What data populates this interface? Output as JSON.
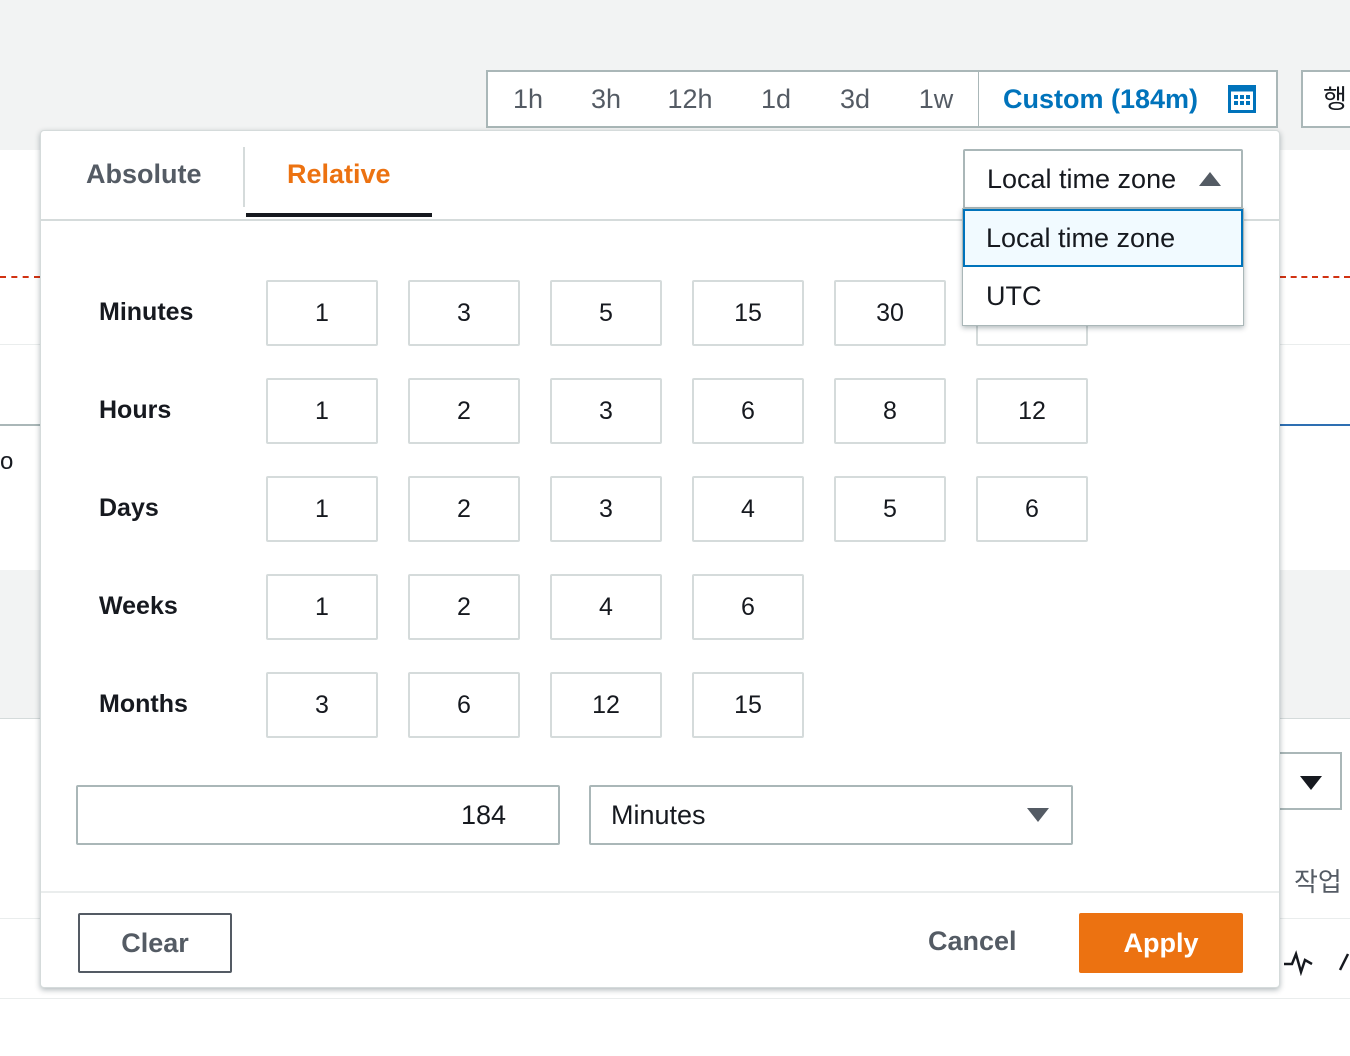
{
  "range_bar": {
    "quick_ranges": [
      "1h",
      "3h",
      "12h",
      "1d",
      "3d",
      "1w"
    ],
    "custom_label": "Custom (184m)"
  },
  "background": {
    "korean_button_label": "행",
    "actions_label": "작업",
    "fragment": "o"
  },
  "popover": {
    "tabs": {
      "absolute": "Absolute",
      "relative": "Relative"
    },
    "active_tab": "Relative",
    "timezone": {
      "selected": "Local time zone",
      "options": [
        "Local time zone",
        "UTC"
      ]
    },
    "units": [
      {
        "label": "Minutes",
        "values": [
          "1",
          "3",
          "5",
          "15",
          "30"
        ]
      },
      {
        "label": "Hours",
        "values": [
          "1",
          "2",
          "3",
          "6",
          "8",
          "12"
        ]
      },
      {
        "label": "Days",
        "values": [
          "1",
          "2",
          "3",
          "4",
          "5",
          "6"
        ]
      },
      {
        "label": "Weeks",
        "values": [
          "1",
          "2",
          "4",
          "6"
        ]
      },
      {
        "label": "Months",
        "values": [
          "3",
          "6",
          "12",
          "15"
        ]
      }
    ],
    "duration": {
      "value": "184",
      "unit": "Minutes"
    },
    "buttons": {
      "clear": "Clear",
      "cancel": "Cancel",
      "apply": "Apply"
    }
  },
  "colors": {
    "accent": "#ec7211",
    "link": "#0073bb",
    "border": "#aab7b8"
  }
}
